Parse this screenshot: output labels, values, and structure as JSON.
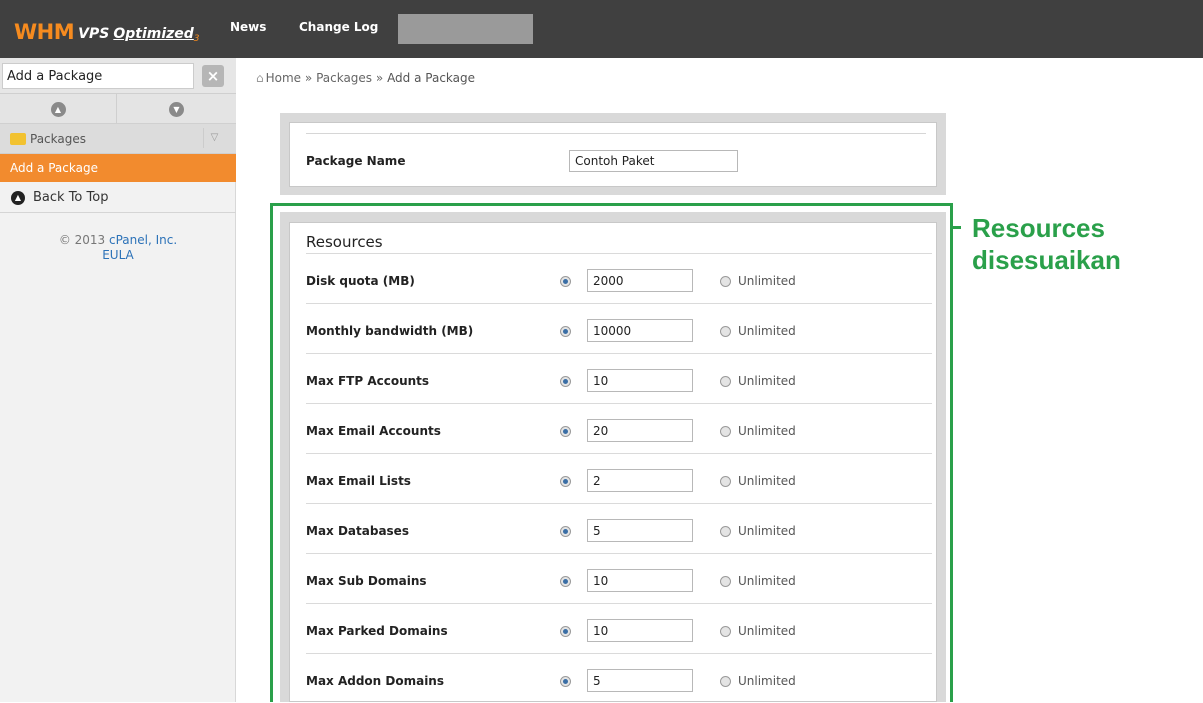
{
  "topbar": {
    "logo_whm": "WHM",
    "logo_vps": "VPS",
    "logo_optimized": "Optimized",
    "logo_sub": "3",
    "nav": [
      "News",
      "Change Log"
    ]
  },
  "sidebar": {
    "search_value": "Add a Package",
    "category": "Packages",
    "active_item": "Add a Package",
    "back_to_top": "Back To Top",
    "copyright_prefix": "© 2013",
    "copyright_link": "cPanel, Inc.",
    "eula": "EULA"
  },
  "breadcrumb": {
    "home": "Home",
    "sep": "»",
    "packages": "Packages",
    "current": "Add a Package"
  },
  "package": {
    "name_label": "Package Name",
    "name_value": "Contoh Paket"
  },
  "resources": {
    "title": "Resources",
    "unlimited_label": "Unlimited",
    "rows": [
      {
        "label": "Disk quota (MB)",
        "value": "2000"
      },
      {
        "label": "Monthly bandwidth (MB)",
        "value": "10000"
      },
      {
        "label": "Max FTP Accounts",
        "value": "10"
      },
      {
        "label": "Max Email Accounts",
        "value": "20"
      },
      {
        "label": "Max Email Lists",
        "value": "2"
      },
      {
        "label": "Max Databases",
        "value": "5"
      },
      {
        "label": "Max Sub Domains",
        "value": "10"
      },
      {
        "label": "Max Parked Domains",
        "value": "10"
      },
      {
        "label": "Max Addon Domains",
        "value": "5"
      }
    ]
  },
  "annotation": {
    "line1": "Resources",
    "line2": "disesuaikan",
    "color": "#2aa04a"
  },
  "colors": {
    "topbar": "#404040",
    "brand_orange": "#f68b1f",
    "active_item": "#f28b2e",
    "link": "#2c72b8"
  }
}
